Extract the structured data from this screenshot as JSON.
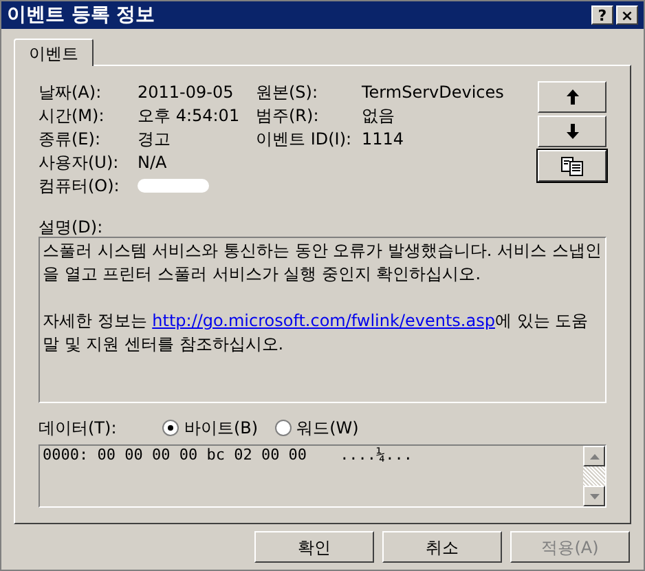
{
  "window": {
    "title": "이벤트 등록 정보",
    "buttons": [
      "?",
      "×"
    ]
  },
  "tabs": [
    {
      "label": "이벤트",
      "selected": true
    }
  ],
  "fields_left": [
    {
      "label": "날짜(A):",
      "value": "2011-09-05"
    },
    {
      "label": "시간(M):",
      "value": "오후 4:54:01"
    },
    {
      "label": "종류(E):",
      "value": "경고"
    },
    {
      "label": "사용자(U):",
      "value": "N/A"
    },
    {
      "label": "컴퓨터(O):",
      "redacted": true
    }
  ],
  "fields_right": [
    {
      "label": "원본(S):",
      "value": "TermServDevices"
    },
    {
      "label": "범주(R):",
      "value": "없음"
    },
    {
      "label": "이벤트 ID(I):",
      "value": "1114"
    }
  ],
  "nav_buttons": [
    {
      "kind": "up"
    },
    {
      "kind": "down"
    },
    {
      "kind": "copy"
    }
  ],
  "description": {
    "label": "설명(D):",
    "paragraphs": [
      {
        "text": "스풀러 시스템 서비스와 통신하는 동안 오류가 발생했습니다. 서비스 스냅인을 열고 프린터 스풀러 서비스가 실행 중인지 확인하십시오."
      },
      {
        "before": "자세한 정보는 ",
        "link": "http://go.microsoft.com/fwlink/events.asp",
        "after": "에 있는 도움말 및 지원 센터를 참조하십시오."
      }
    ]
  },
  "data": {
    "label": "데이터(T):",
    "options": [
      {
        "label": "바이트(B)",
        "selected": true
      },
      {
        "label": "워드(W)",
        "selected": false
      }
    ],
    "lines": [
      {
        "offset": "0000:",
        "bytes": "00 00 00 00 bc 02 00 00",
        "ascii": "....¼..."
      }
    ]
  },
  "footer_buttons": [
    {
      "label": "확인",
      "disabled": false
    },
    {
      "label": "취소",
      "disabled": false
    },
    {
      "label": "적용(A)",
      "disabled": true
    }
  ]
}
